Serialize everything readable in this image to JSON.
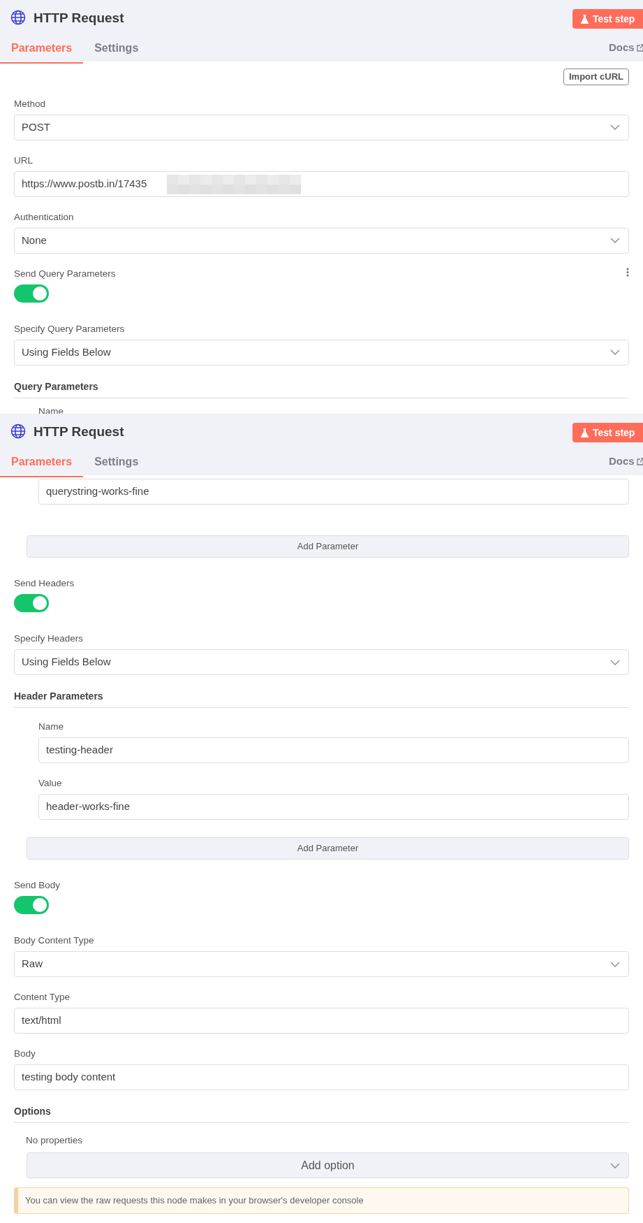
{
  "panels": [
    {
      "header": {
        "title": "HTTP Request",
        "test_button": "Test step",
        "tabs": [
          {
            "label": "Parameters",
            "selected": true
          },
          {
            "label": "Settings",
            "selected": false
          }
        ],
        "docs": "Docs"
      },
      "import_button": "Import cURL",
      "items": [
        {
          "kind": "select",
          "label": "Method",
          "value": "POST"
        },
        {
          "kind": "input",
          "label": "URL",
          "value": "https://www.postb.in/17435",
          "redacted": true
        },
        {
          "kind": "select",
          "label": "Authentication",
          "value": "None"
        },
        {
          "kind": "toggle",
          "label": "Send Query Parameters",
          "on": true,
          "menu": true
        },
        {
          "kind": "select",
          "label": "Specify Query Parameters",
          "value": "Using Fields Below"
        },
        {
          "kind": "section",
          "label": "Query Parameters"
        },
        {
          "kind": "sublabel",
          "label": "Name"
        }
      ]
    },
    {
      "header": {
        "title": "HTTP Request",
        "test_button": "Test step",
        "tabs": [
          {
            "label": "Parameters",
            "selected": true
          },
          {
            "label": "Settings",
            "selected": false
          }
        ],
        "docs": "Docs"
      },
      "items": [
        {
          "kind": "subinput",
          "value": "querystring-works-fine"
        },
        {
          "kind": "addbutton",
          "label": "Add Parameter"
        },
        {
          "kind": "toggle",
          "label": "Send Headers",
          "on": true
        },
        {
          "kind": "select",
          "label": "Specify Headers",
          "value": "Using Fields Below"
        },
        {
          "kind": "section",
          "label": "Header Parameters"
        },
        {
          "kind": "subfield",
          "label": "Name",
          "value": "testing-header"
        },
        {
          "kind": "subfield",
          "label": "Value",
          "value": "header-works-fine"
        },
        {
          "kind": "addbutton",
          "label": "Add Parameter"
        },
        {
          "kind": "toggle",
          "label": "Send Body",
          "on": true
        },
        {
          "kind": "select",
          "label": "Body Content Type",
          "value": "Raw"
        },
        {
          "kind": "input",
          "label": "Content Type",
          "value": "text/html"
        },
        {
          "kind": "input",
          "label": "Body",
          "value": "testing body content"
        },
        {
          "kind": "section",
          "label": "Options"
        },
        {
          "kind": "empty",
          "label": "No properties"
        },
        {
          "kind": "addoption",
          "label": "Add option"
        },
        {
          "kind": "note",
          "text": "You can view the raw requests this node makes in your browser's developer console"
        }
      ]
    }
  ]
}
